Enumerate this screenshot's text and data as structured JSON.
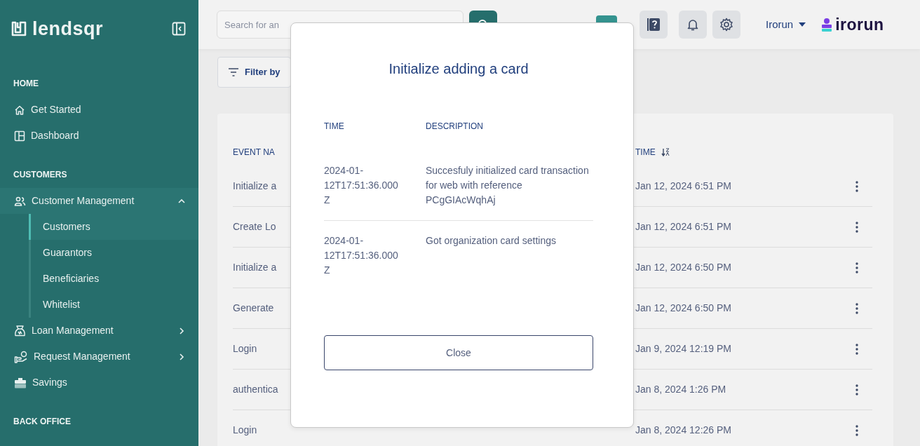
{
  "sidebar": {
    "brand": "lendsqr",
    "sections": [
      {
        "heading": "HOME",
        "items": [
          {
            "label": "Get Started"
          },
          {
            "label": "Dashboard"
          }
        ]
      },
      {
        "heading": "CUSTOMERS",
        "items": [
          {
            "label": "Customer Management",
            "expanded": true,
            "children": [
              {
                "label": "Customers",
                "selected": true
              },
              {
                "label": "Guarantors",
                "selected": false
              },
              {
                "label": "Beneficiaries",
                "selected": false
              },
              {
                "label": "Whitelist",
                "selected": false
              }
            ]
          },
          {
            "label": "Loan Management",
            "expanded": false
          },
          {
            "label": "Request Management",
            "expanded": false
          },
          {
            "label": "Savings"
          }
        ]
      },
      {
        "heading": "BACK OFFICE"
      }
    ]
  },
  "topbar": {
    "search": {
      "placeholder": "Search for an"
    },
    "user": "Irorun",
    "org_logo": "irorun"
  },
  "filter": {
    "label": "Filter by"
  },
  "table": {
    "columns": [
      "EVENT NA",
      "TIME"
    ],
    "rows": [
      {
        "event": "Initialize a",
        "time": "Jan 12, 2024 6:51 PM"
      },
      {
        "event": "Create Lo",
        "time": "Jan 12, 2024 6:51 PM"
      },
      {
        "event": "Initialize a",
        "time": "Jan 12, 2024 6:50 PM"
      },
      {
        "event": "Generate",
        "time": "Jan 12, 2024 6:50 PM"
      },
      {
        "event": "Login",
        "time": "Jan 9, 2024 12:19 PM"
      },
      {
        "event": "authentica",
        "time": "Jan 8, 2024 1:26 PM"
      },
      {
        "event": "Login",
        "time": "Jan 8, 2024 12:26 PM"
      }
    ]
  },
  "modal": {
    "title": "Initialize adding a card",
    "columns": [
      "TIME",
      "DESCRIPTION"
    ],
    "rows": [
      {
        "time": "2024-01-12T17:51:36.000Z",
        "description": "Succesfuly initialized card transaction for web with reference PCgGIAcWqhAj"
      },
      {
        "time": "2024-01-12T17:51:36.000Z",
        "description": "Got organization card settings"
      }
    ],
    "button": "Close"
  }
}
